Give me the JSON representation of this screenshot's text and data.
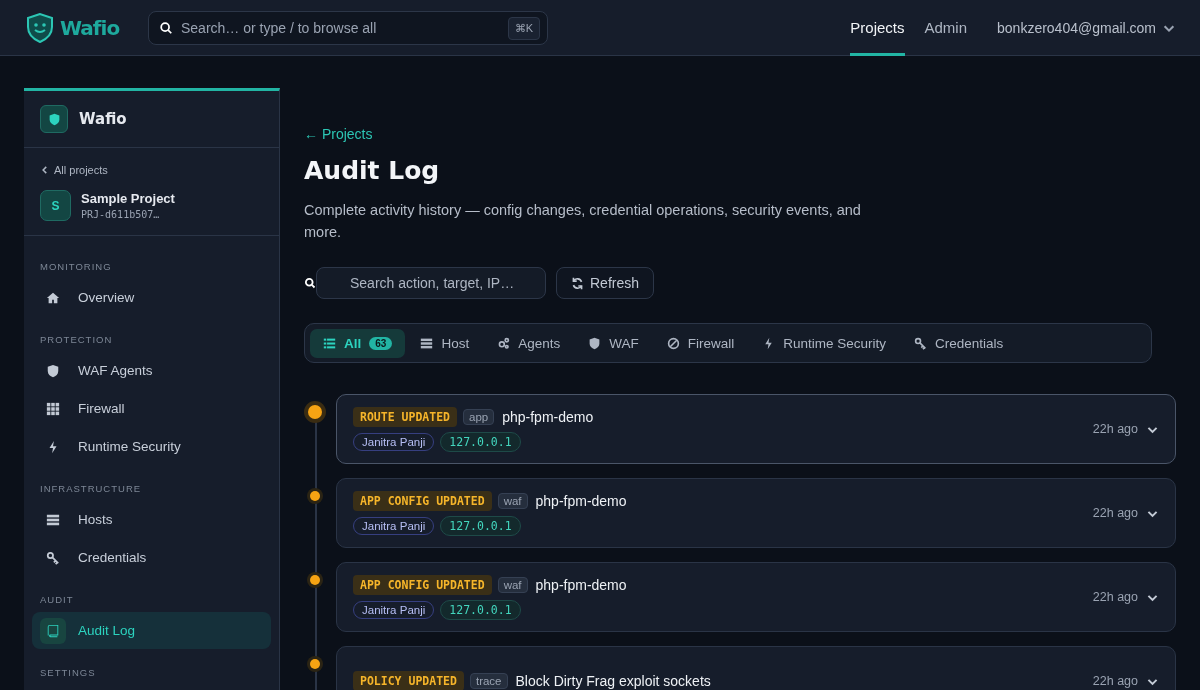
{
  "header": {
    "logo": "Wafio",
    "search": {
      "placeholder": "Search… or type / to browse all",
      "shortcut": "⌘K"
    },
    "nav": [
      {
        "label": "Projects",
        "selected": true
      },
      {
        "label": "Admin",
        "selected": false
      }
    ],
    "account": "bonkzero404@gmail.com"
  },
  "sidebar": {
    "org": "Wafio",
    "back": "All projects",
    "project": {
      "initial": "S",
      "name": "Sample Project",
      "id": "PRJ-d611b507…"
    },
    "sections": [
      {
        "title": "MONITORING",
        "items": [
          {
            "label": "Overview",
            "selected": false
          }
        ]
      },
      {
        "title": "PROTECTION",
        "items": [
          {
            "label": "WAF Agents",
            "selected": false
          },
          {
            "label": "Firewall",
            "selected": false
          },
          {
            "label": "Runtime Security",
            "selected": false
          }
        ]
      },
      {
        "title": "INFRASTRUCTURE",
        "items": [
          {
            "label": "Hosts",
            "selected": false
          },
          {
            "label": "Credentials",
            "selected": false
          }
        ]
      },
      {
        "title": "AUDIT",
        "items": [
          {
            "label": "Audit Log",
            "selected": true
          }
        ]
      },
      {
        "title": "SETTINGS"
      }
    ]
  },
  "page": {
    "back": "← Projects",
    "title": "Audit Log",
    "description": "Complete activity history — config changes, credential operations, security events, and more.",
    "search": {
      "placeholder": "Search action, target, IP…"
    },
    "refresh": "Refresh",
    "filters": [
      {
        "label": "All",
        "count": "63",
        "selected": true
      },
      {
        "label": "Host",
        "selected": false
      },
      {
        "label": "Agents",
        "selected": false
      },
      {
        "label": "WAF",
        "selected": false
      },
      {
        "label": "Firewall",
        "selected": false
      },
      {
        "label": "Runtime Security",
        "selected": false
      },
      {
        "label": "Credentials",
        "selected": false
      }
    ],
    "entries": [
      {
        "action": "ROUTE UPDATED",
        "source": "app",
        "target": "php-fpm-demo",
        "user": "Janitra Panji",
        "ip": "127.0.0.1",
        "time": "22h ago",
        "selected": true
      },
      {
        "action": "APP CONFIG UPDATED",
        "source": "waf",
        "target": "php-fpm-demo",
        "user": "Janitra Panji",
        "ip": "127.0.0.1",
        "time": "22h ago",
        "selected": false
      },
      {
        "action": "APP CONFIG UPDATED",
        "source": "waf",
        "target": "php-fpm-demo",
        "user": "Janitra Panji",
        "ip": "127.0.0.1",
        "time": "22h ago",
        "selected": false
      },
      {
        "action": "POLICY UPDATED",
        "source": "trace",
        "target": "Block Dirty Frag exploit sockets",
        "time": "22h ago",
        "selected": false
      }
    ]
  }
}
